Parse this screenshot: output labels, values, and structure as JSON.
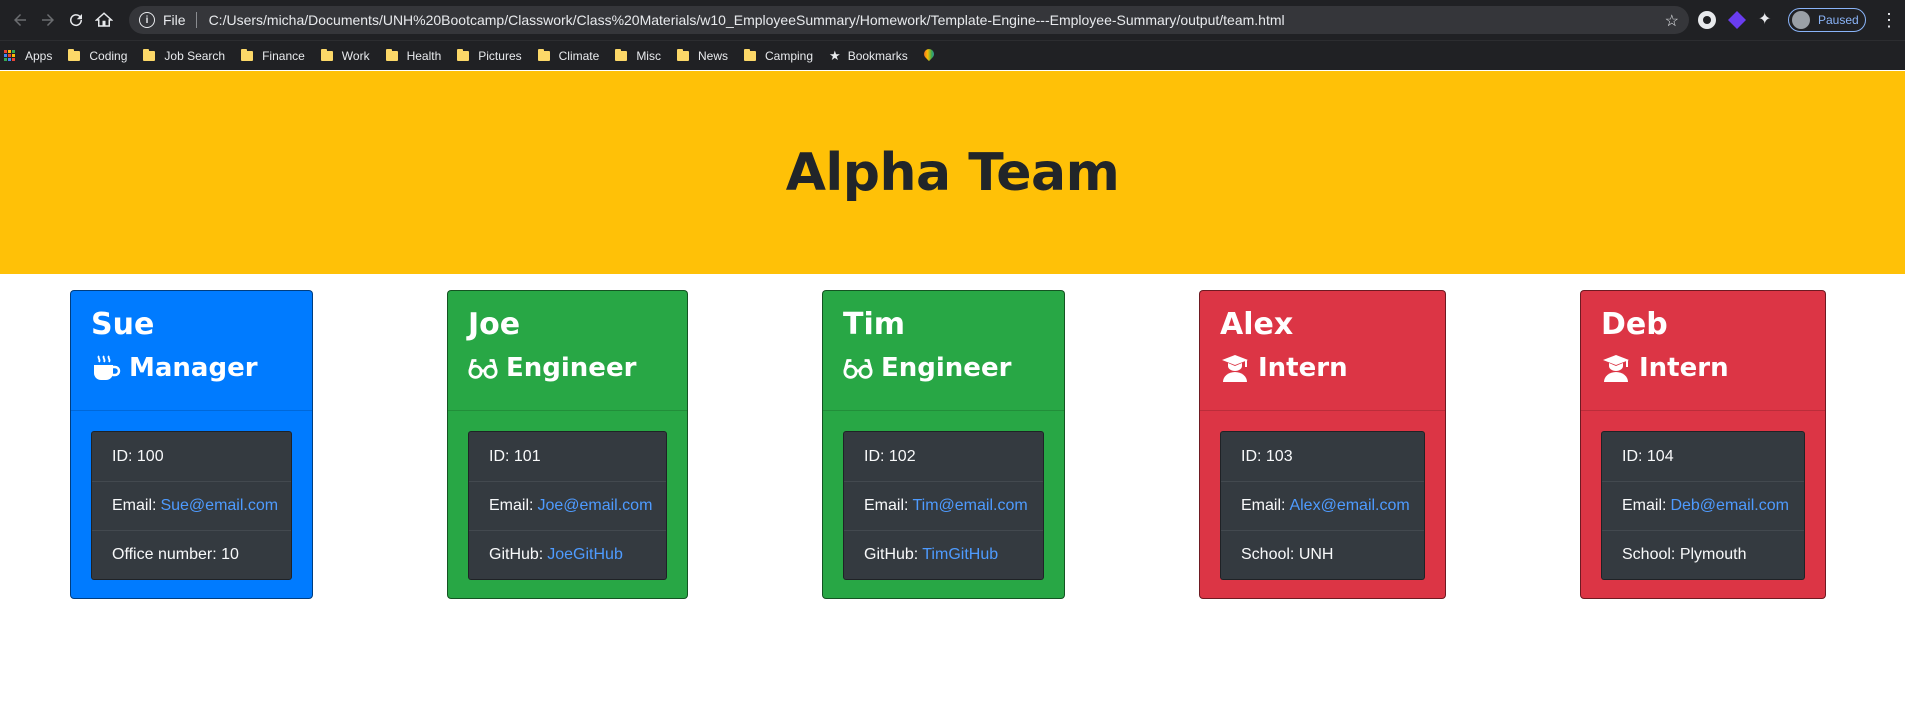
{
  "browser": {
    "file_label": "File",
    "url": "C:/Users/micha/Documents/UNH%20Bootcamp/Classwork/Class%20Materials/w10_EmployeeSummary/Homework/Template-Engine---Employee-Summary/output/team.html",
    "profile_status": "Paused",
    "bookmarks": [
      {
        "label": "Apps",
        "icon": "apps-grid-icon"
      },
      {
        "label": "Coding",
        "icon": "folder-icon"
      },
      {
        "label": "Job Search",
        "icon": "folder-icon"
      },
      {
        "label": "Finance",
        "icon": "folder-icon"
      },
      {
        "label": "Work",
        "icon": "folder-icon"
      },
      {
        "label": "Health",
        "icon": "folder-icon"
      },
      {
        "label": "Pictures",
        "icon": "folder-icon"
      },
      {
        "label": "Climate",
        "icon": "folder-icon"
      },
      {
        "label": "Misc",
        "icon": "folder-icon"
      },
      {
        "label": "News",
        "icon": "folder-icon"
      },
      {
        "label": "Camping",
        "icon": "folder-icon"
      },
      {
        "label": "Bookmarks",
        "icon": "star-icon"
      }
    ]
  },
  "page": {
    "title": "Alpha Team",
    "header_color": "#ffc107"
  },
  "colors": {
    "manager": "#007bff",
    "engineer": "#28a745",
    "intern": "#dc3545",
    "list_bg": "#343a40",
    "link": "#4e9bff"
  },
  "employees": [
    {
      "name": "Sue",
      "role": "Manager",
      "icon": "coffee-mug-icon",
      "id_label": "ID: 100",
      "email_prefix": "Email:",
      "email": "Sue@email.com",
      "extra_prefix": "Office number: 10",
      "extra_link": ""
    },
    {
      "name": "Joe",
      "role": "Engineer",
      "icon": "glasses-icon",
      "id_label": "ID: 101",
      "email_prefix": "Email:",
      "email": "Joe@email.com",
      "extra_prefix": "GitHub:",
      "extra_link": "JoeGitHub"
    },
    {
      "name": "Tim",
      "role": "Engineer",
      "icon": "glasses-icon",
      "id_label": "ID: 102",
      "email_prefix": "Email:",
      "email": "Tim@email.com",
      "extra_prefix": "GitHub:",
      "extra_link": "TimGitHub"
    },
    {
      "name": "Alex",
      "role": "Intern",
      "icon": "graduate-icon",
      "id_label": "ID: 103",
      "email_prefix": "Email:",
      "email": "Alex@email.com",
      "extra_prefix": "School: UNH",
      "extra_link": ""
    },
    {
      "name": "Deb",
      "role": "Intern",
      "icon": "graduate-icon",
      "id_label": "ID: 104",
      "email_prefix": "Email:",
      "email": "Deb@email.com",
      "extra_prefix": "School: Plymouth",
      "extra_link": ""
    }
  ]
}
